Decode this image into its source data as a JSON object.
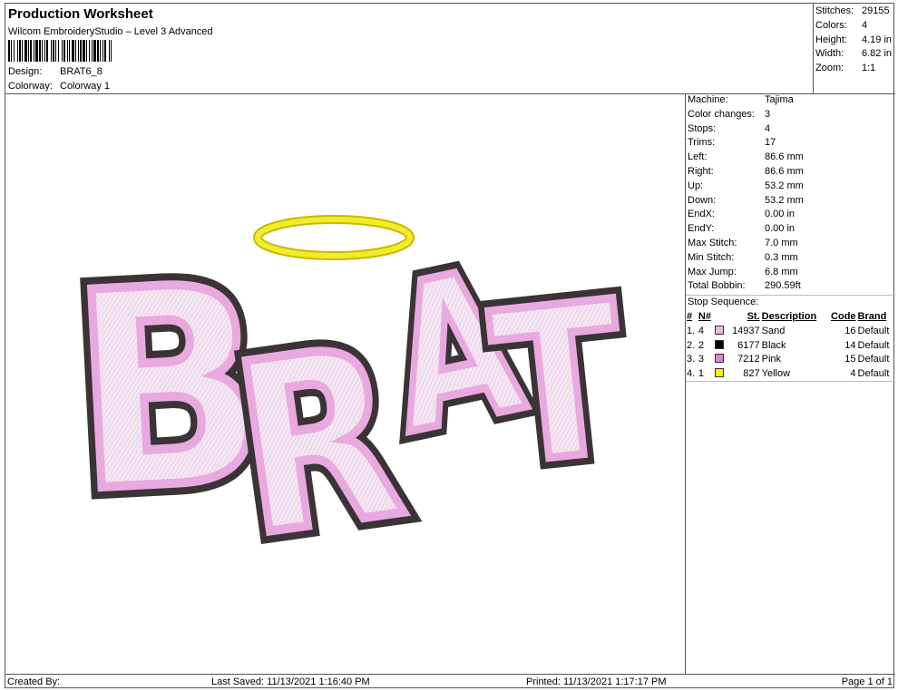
{
  "header": {
    "title": "Production Worksheet",
    "software": "Wilcom EmbroideryStudio – Level 3 Advanced",
    "design_label": "Design:",
    "design_value": "BRAT6_8",
    "colorway_label": "Colorway:",
    "colorway_value": "Colorway 1"
  },
  "stats": [
    {
      "label": "Stitches:",
      "value": "29155"
    },
    {
      "label": "Colors:",
      "value": "4"
    },
    {
      "label": "Height:",
      "value": "4.19 in"
    },
    {
      "label": "Width:",
      "value": "6.82 in"
    },
    {
      "label": "Zoom:",
      "value": "1:1"
    }
  ],
  "machine_info": [
    {
      "label": "Machine:",
      "value": "Tajima"
    },
    {
      "label": "Color changes:",
      "value": "3"
    },
    {
      "label": "Stops:",
      "value": "4"
    },
    {
      "label": "Trims:",
      "value": "17"
    },
    {
      "label": "Left:",
      "value": "86.6 mm"
    },
    {
      "label": "Right:",
      "value": "86.6 mm"
    },
    {
      "label": "Up:",
      "value": "53.2 mm"
    },
    {
      "label": "Down:",
      "value": "53.2 mm"
    },
    {
      "label": "EndX:",
      "value": "0.00 in"
    },
    {
      "label": "EndY:",
      "value": "0.00 in"
    },
    {
      "label": "Max Stitch:",
      "value": "7.0 mm"
    },
    {
      "label": "Min Stitch:",
      "value": "0.3 mm"
    },
    {
      "label": "Max Jump:",
      "value": "6.8 mm"
    },
    {
      "label": "Total Bobbin:",
      "value": "290.59ft"
    }
  ],
  "stop_sequence": {
    "title": "Stop Sequence:",
    "headers": {
      "num": "#",
      "n": "N#",
      "st": "St.",
      "description": "Description",
      "code": "Code",
      "brand": "Brand"
    },
    "rows": [
      {
        "num": "1.",
        "n": "4",
        "color": "#e9b8e6",
        "st": "14937",
        "description": "Sand",
        "code": "16",
        "brand": "Default"
      },
      {
        "num": "2.",
        "n": "2",
        "color": "#000000",
        "st": "6177",
        "description": "Black",
        "code": "14",
        "brand": "Default"
      },
      {
        "num": "3.",
        "n": "3",
        "color": "#e77fc9",
        "st": "7212",
        "description": "Pink",
        "code": "15",
        "brand": "Default"
      },
      {
        "num": "4.",
        "n": "1",
        "color": "#f5f000",
        "st": "827",
        "description": "Yellow",
        "code": "4",
        "brand": "Default"
      }
    ]
  },
  "design": {
    "text": "BRAT",
    "colors": {
      "pink": "#e9a8df",
      "fill": "#f1e1ef",
      "outline": "#3a3436",
      "halo": "#f2ec2a",
      "halo_edge": "#c9b800"
    }
  },
  "footer": {
    "created_by": "Created By:",
    "last_saved": "Last Saved: 11/13/2021 1:16:40 PM",
    "printed": "Printed: 11/13/2021 1:17:17 PM",
    "page": "Page 1 of 1"
  }
}
